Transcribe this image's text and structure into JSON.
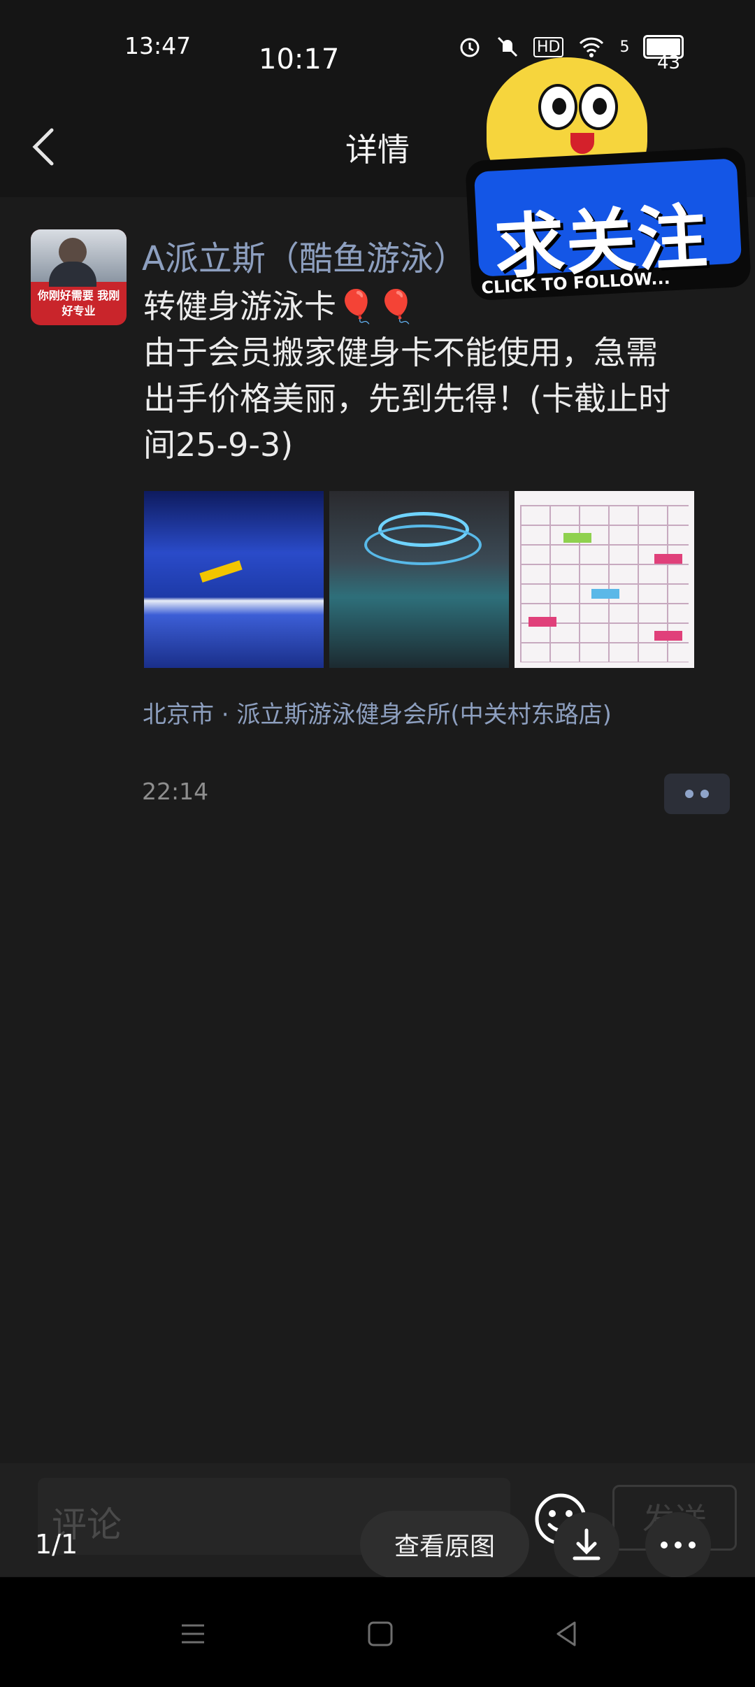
{
  "status_bar": {
    "overlay_time": "13:47",
    "time": "10:17",
    "network_badge": "HD",
    "signal_label": "5",
    "battery": "43"
  },
  "header": {
    "title": "详情"
  },
  "post": {
    "author": "A派立斯（酷鱼游泳）",
    "avatar_slogan": "你刚好需要 我刚好专业",
    "lines": [
      "转健身游泳卡🎈🎈",
      "由于会员搬家健身卡不能使用，急需",
      "出手价格美丽，先到先得！(卡截止时",
      "间25-9-3)"
    ],
    "location": "北京市 · 派立斯游泳健身会所(中关村东路店)",
    "time": "22:14"
  },
  "sticker": {
    "main_text": "求关注",
    "sub_text": "CLICK TO FOLLOW..."
  },
  "comment": {
    "placeholder": "评论",
    "send_label": "发送"
  },
  "viewer": {
    "page_indicator": "1/1",
    "view_original_label": "查看原图"
  },
  "icons": {
    "back": "chevron-left-icon",
    "emoji": "smiley-icon",
    "download": "download-icon",
    "menu": "more-icon",
    "nav_recent": "menu-icon",
    "nav_home": "square-icon",
    "nav_back": "triangle-back-icon"
  },
  "colors": {
    "background": "#1b1b1b",
    "link": "#8d9fbf",
    "sticker_blue": "#1456e6",
    "sticker_yellow": "#f6d53d"
  }
}
